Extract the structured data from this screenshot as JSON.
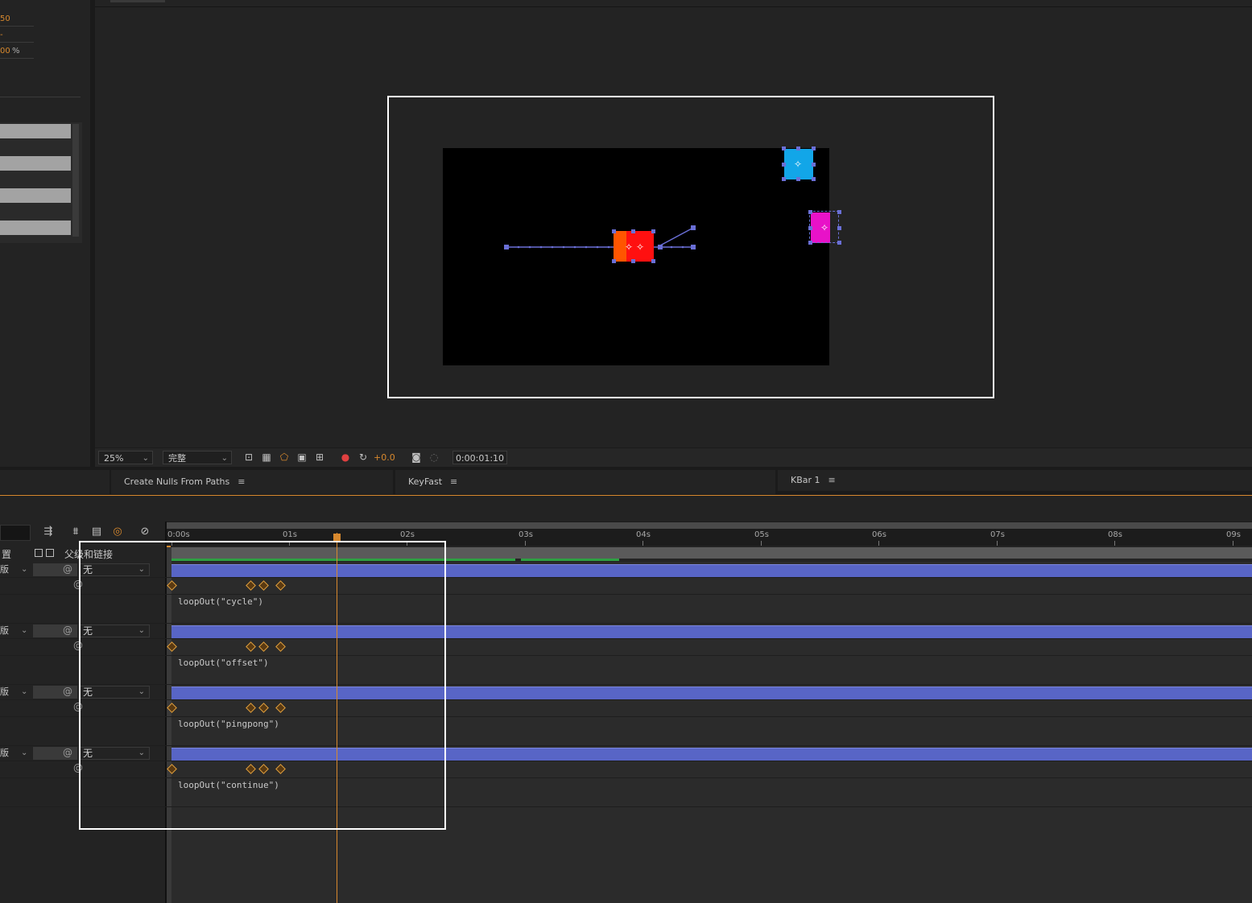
{
  "left_panel": {
    "values": [
      "50",
      "-",
      "00"
    ],
    "percent": "%"
  },
  "viewer_toolbar": {
    "zoom": "25%",
    "resolution": "完整",
    "exposure": "+0.0",
    "timecode": "0:00:01:10"
  },
  "tabs": [
    {
      "label": "Create Nulls From Paths",
      "menu": "≡"
    },
    {
      "label": "KeyFast",
      "menu": "≡"
    },
    {
      "label": "KBar 1",
      "menu": "≡"
    }
  ],
  "timeline": {
    "column_header_left": "置",
    "column_header_parent": "父级和链接",
    "ruler": [
      "0:00s",
      "01s",
      "02s",
      "03s",
      "04s",
      "05s",
      "06s",
      "07s",
      "08s",
      "09s"
    ],
    "layers": [
      {
        "mode": "版",
        "parent": "无",
        "expression": "loopOut(\"cycle\")"
      },
      {
        "mode": "版",
        "parent": "无",
        "expression": "loopOut(\"offset\")"
      },
      {
        "mode": "版",
        "parent": "无",
        "expression": "loopOut(\"pingpong\")"
      },
      {
        "mode": "版",
        "parent": "无",
        "expression": "loopOut(\"continue\")"
      }
    ]
  },
  "colors": {
    "accent": "#d8892e",
    "layer_bar": "#5865c6",
    "red_layer": "#ff1010",
    "blue_layer": "#12a6e8",
    "magenta_layer": "#e812c8"
  },
  "icons": [
    "camera-icon",
    "color-channel-icon",
    "reset-exposure-icon",
    "region-of-interest-icon",
    "transparency-grid-icon",
    "mask-toggle-icon",
    "grid-icon",
    "safe-area-icon"
  ]
}
